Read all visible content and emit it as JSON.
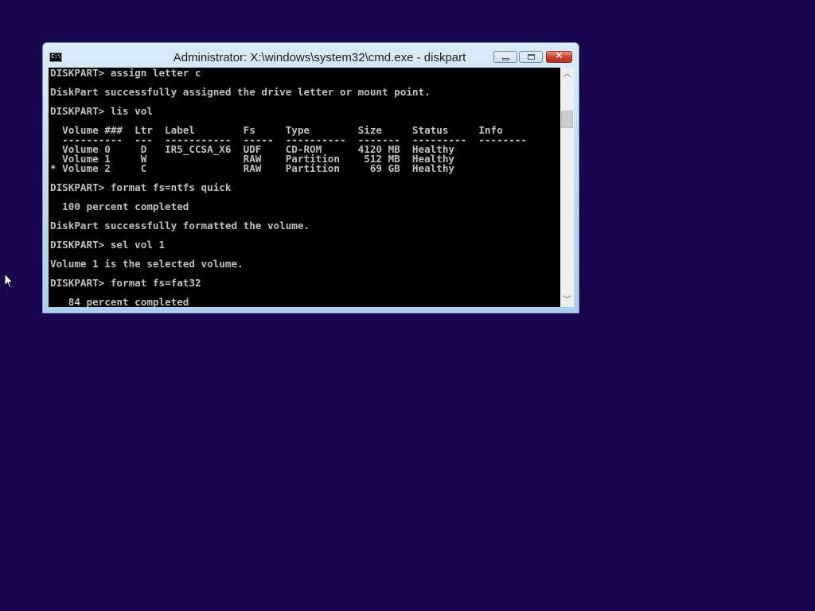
{
  "window": {
    "title": "Administrator: X:\\windows\\system32\\cmd.exe - diskpart",
    "icon_text": "C:\\.",
    "icon": "console-icon",
    "minimize_icon": "minimize-icon",
    "maximize_icon": "maximize-icon",
    "close_icon": "close-icon",
    "close_glyph": "✕"
  },
  "console": {
    "lines": [
      "DISKPART> assign letter c",
      "",
      "DiskPart successfully assigned the drive letter or mount point.",
      "",
      "DISKPART> lis vol",
      "",
      "  Volume ###  Ltr  Label        Fs     Type        Size     Status     Info",
      "  ----------  ---  -----------  -----  ----------  -------  ---------  --------",
      "  Volume 0     D   IR5_CCSA_X6  UDF    CD-ROM      4120 MB  Healthy",
      "  Volume 1     W                RAW    Partition    512 MB  Healthy",
      "* Volume 2     C                RAW    Partition     69 GB  Healthy",
      "",
      "DISKPART> format fs=ntfs quick",
      "",
      "  100 percent completed",
      "",
      "DiskPart successfully formatted the volume.",
      "",
      "DISKPART> sel vol 1",
      "",
      "Volume 1 is the selected volume.",
      "",
      "DISKPART> format fs=fat32",
      "",
      "   84 percent completed"
    ]
  },
  "scrollbar": {
    "up_glyph": "︿",
    "down_glyph": "﹀"
  },
  "colors": {
    "desktop_background": "#19064f",
    "console_background": "#000000",
    "console_text": "#c0c0c0",
    "close_button": "#c7432c"
  }
}
